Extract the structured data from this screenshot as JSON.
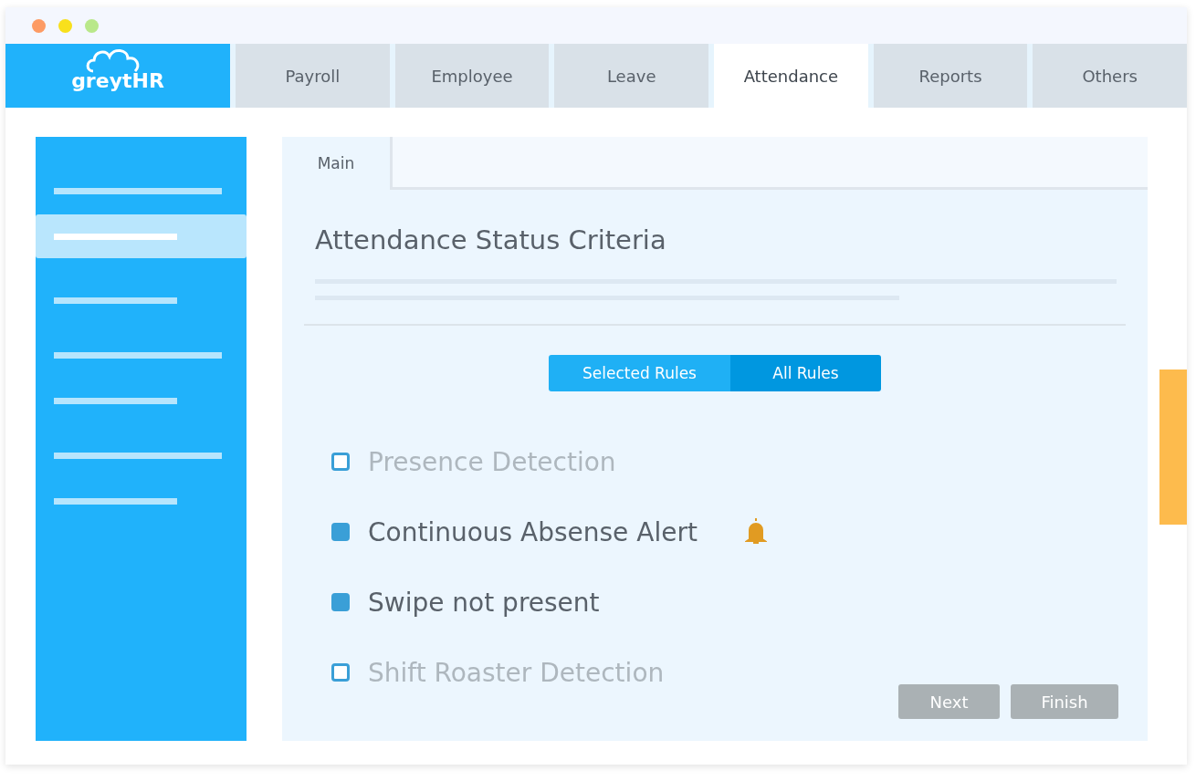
{
  "brand": {
    "logo": "greytHR"
  },
  "tabs": [
    {
      "label": "Payroll",
      "selected": false
    },
    {
      "label": "Employee",
      "selected": false
    },
    {
      "label": "Leave",
      "selected": false
    },
    {
      "label": "Attendance",
      "selected": true
    },
    {
      "label": "Reports",
      "selected": false
    },
    {
      "label": "Others",
      "selected": false
    }
  ],
  "sidebar": {
    "items": [
      {
        "selected": false
      },
      {
        "selected": true
      },
      {
        "selected": false
      },
      {
        "selected": false
      },
      {
        "selected": false
      },
      {
        "selected": false
      },
      {
        "selected": false
      }
    ]
  },
  "panel": {
    "tabs": [
      {
        "label": "Main",
        "selected": true
      }
    ],
    "title": "Attendance Status Criteria",
    "toggle": [
      {
        "label": "Selected Rules",
        "selected": false
      },
      {
        "label": "All Rules",
        "selected": true
      }
    ],
    "rules": [
      {
        "label": "Presence Detection",
        "checked": false,
        "alert": false
      },
      {
        "label": "Continuous Absense Alert",
        "checked": true,
        "alert": true
      },
      {
        "label": "Swipe not present",
        "checked": true,
        "alert": false
      },
      {
        "label": "Shift Roaster Detection",
        "checked": false,
        "alert": false
      }
    ],
    "buttons": [
      "Next",
      "Finish"
    ]
  }
}
